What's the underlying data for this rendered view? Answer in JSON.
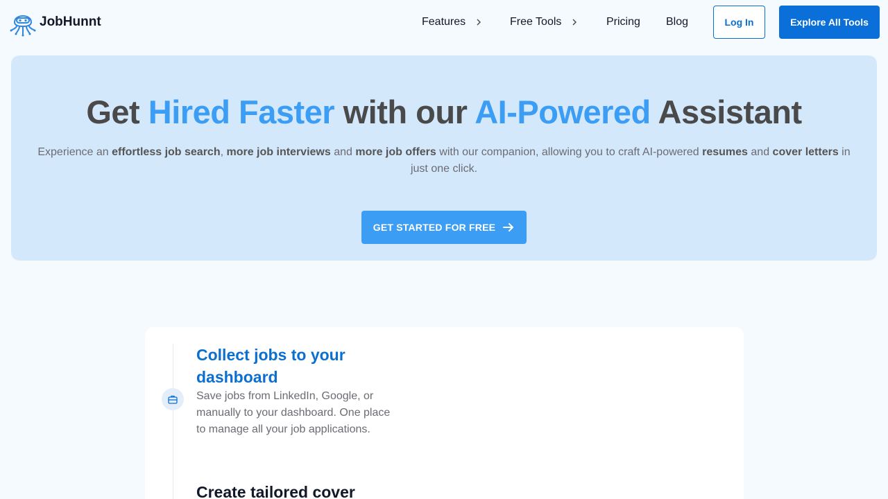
{
  "header": {
    "logo_text": "JobHunnt",
    "nav": [
      {
        "label": "Features"
      },
      {
        "label": "Free Tools"
      },
      {
        "label": "Pricing"
      },
      {
        "label": "Blog"
      }
    ],
    "login_label": "Log In",
    "explore_label": "Explore All Tools"
  },
  "hero": {
    "title_parts": [
      "Get ",
      "Hired Faster",
      " with our ",
      "AI-Powered",
      " Assistant"
    ],
    "subtitle_parts": [
      "Experience an ",
      "effortless job search",
      ", ",
      "more job interviews",
      " and ",
      "more job offers",
      " with our companion, allowing you to craft AI-powered ",
      "resumes",
      " and ",
      "cover letters",
      " in just one click."
    ],
    "cta_label": "GET STARTED FOR FREE"
  },
  "features": {
    "step1_title": "Collect jobs to your dashboard",
    "step1_desc": "Save jobs from LinkedIn, Google, or manually to your dashboard. One place to manage all your job applications.",
    "step2_title": "Create tailored cover"
  },
  "colors": {
    "accent": "#3b9df3",
    "primary": "#0a6fd8",
    "hero_bg": "#d4e8fc",
    "page_bg": "#f5fafe"
  }
}
